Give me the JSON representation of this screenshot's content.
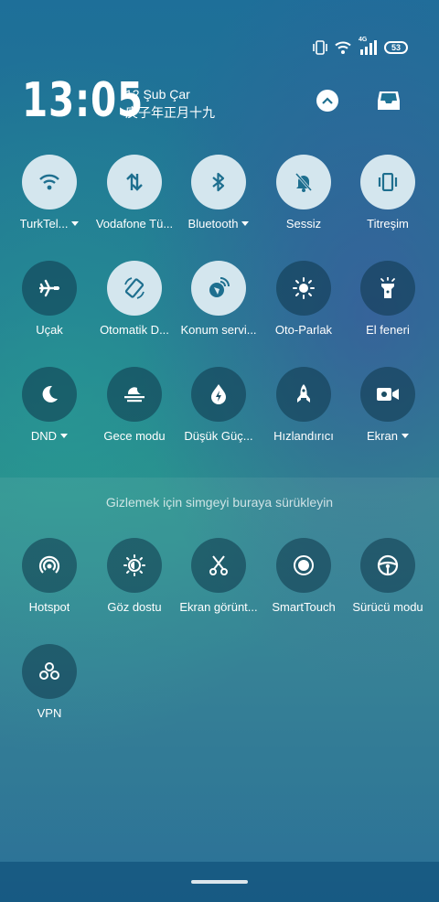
{
  "status_bar": {
    "network_type": "4G",
    "battery_level": "53"
  },
  "header": {
    "time": "13:05",
    "date": "12 Şub Çar",
    "lunar_date": "庚子年正月十九"
  },
  "active_tiles": [
    {
      "label": "TurkTel...",
      "icon": "wifi-icon",
      "state": "on",
      "has_menu": true
    },
    {
      "label": "Vodafone Tü...",
      "icon": "mobile-data-icon",
      "state": "on",
      "has_menu": false
    },
    {
      "label": "Bluetooth",
      "icon": "bluetooth-icon",
      "state": "on",
      "has_menu": true
    },
    {
      "label": "Sessiz",
      "icon": "bell-off-icon",
      "state": "on",
      "has_menu": false
    },
    {
      "label": "Titreşim",
      "icon": "vibrate-icon",
      "state": "on",
      "has_menu": false
    },
    {
      "label": "Uçak",
      "icon": "airplane-icon",
      "state": "off",
      "has_menu": false
    },
    {
      "label": "Otomatik D...",
      "icon": "auto-rotate-icon",
      "state": "on",
      "has_menu": false
    },
    {
      "label": "Konum servi...",
      "icon": "location-icon",
      "state": "on",
      "has_menu": false
    },
    {
      "label": "Oto-Parlak",
      "icon": "brightness-icon",
      "state": "off",
      "has_menu": false
    },
    {
      "label": "El feneri",
      "icon": "flashlight-icon",
      "state": "off",
      "has_menu": false
    },
    {
      "label": "DND",
      "icon": "moon-icon",
      "state": "off",
      "has_menu": true
    },
    {
      "label": "Gece modu",
      "icon": "night-mode-icon",
      "state": "off",
      "has_menu": false
    },
    {
      "label": "Düşük Güç...",
      "icon": "power-saver-icon",
      "state": "off",
      "has_menu": false
    },
    {
      "label": "Hızlandırıcı",
      "icon": "rocket-icon",
      "state": "off",
      "has_menu": false
    },
    {
      "label": "Ekran",
      "icon": "screen-record-icon",
      "state": "off",
      "has_menu": true
    }
  ],
  "drag_hint": "Gizlemek için simgeyi buraya sürükleyin",
  "hidden_tiles": [
    {
      "label": "Hotspot",
      "icon": "hotspot-icon",
      "state": "off"
    },
    {
      "label": "Göz dostu",
      "icon": "eye-comfort-icon",
      "state": "off"
    },
    {
      "label": "Ekran görünt...",
      "icon": "screenshot-icon",
      "state": "off"
    },
    {
      "label": "SmartTouch",
      "icon": "smarttouch-icon",
      "state": "off"
    },
    {
      "label": "Sürücü modu",
      "icon": "steering-wheel-icon",
      "state": "off"
    },
    {
      "label": "VPN",
      "icon": "vpn-icon",
      "state": "off"
    }
  ],
  "colors": {
    "tile_on": "#d4e6ee",
    "icon_on": "#1e6f8f",
    "tile_off": "#0f374b",
    "icon_off": "#ffffff"
  }
}
